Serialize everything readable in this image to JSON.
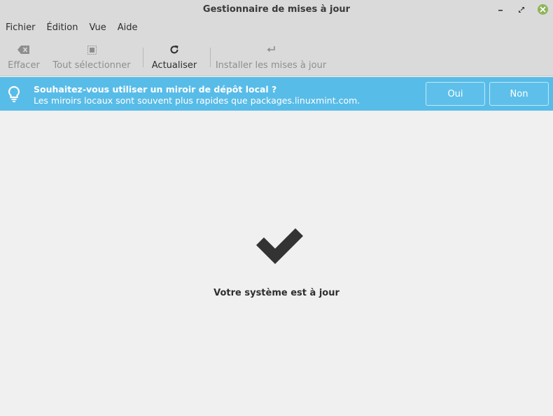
{
  "window": {
    "title": "Gestionnaire de mises à jour",
    "controls": {
      "minimize_icon": "minimize-icon",
      "maximize_icon": "maximize-icon",
      "close_icon": "close-icon",
      "close_color": "#8fb45a"
    }
  },
  "menubar": {
    "items": [
      {
        "label": "Fichier"
      },
      {
        "label": "Édition"
      },
      {
        "label": "Vue"
      },
      {
        "label": "Aide"
      }
    ]
  },
  "toolbar": {
    "clear": {
      "label": "Effacer",
      "icon": "backspace-icon",
      "enabled": false
    },
    "select_all": {
      "label": "Tout sélectionner",
      "icon": "select-all-icon",
      "enabled": false
    },
    "refresh": {
      "label": "Actualiser",
      "icon": "refresh-icon",
      "enabled": true
    },
    "install": {
      "label": "Installer les mises à jour",
      "icon": "return-icon",
      "enabled": false
    }
  },
  "infobar": {
    "icon": "lightbulb-icon",
    "background": "#58bce8",
    "title": "Souhaitez-vous utiliser un miroir de dépôt local ?",
    "message": "Les miroirs locaux sont souvent plus rapides que packages.linuxmint.com.",
    "yes_label": "Oui",
    "no_label": "Non"
  },
  "main": {
    "status_icon": "checkmark-icon",
    "status_text": "Votre système est à jour"
  }
}
